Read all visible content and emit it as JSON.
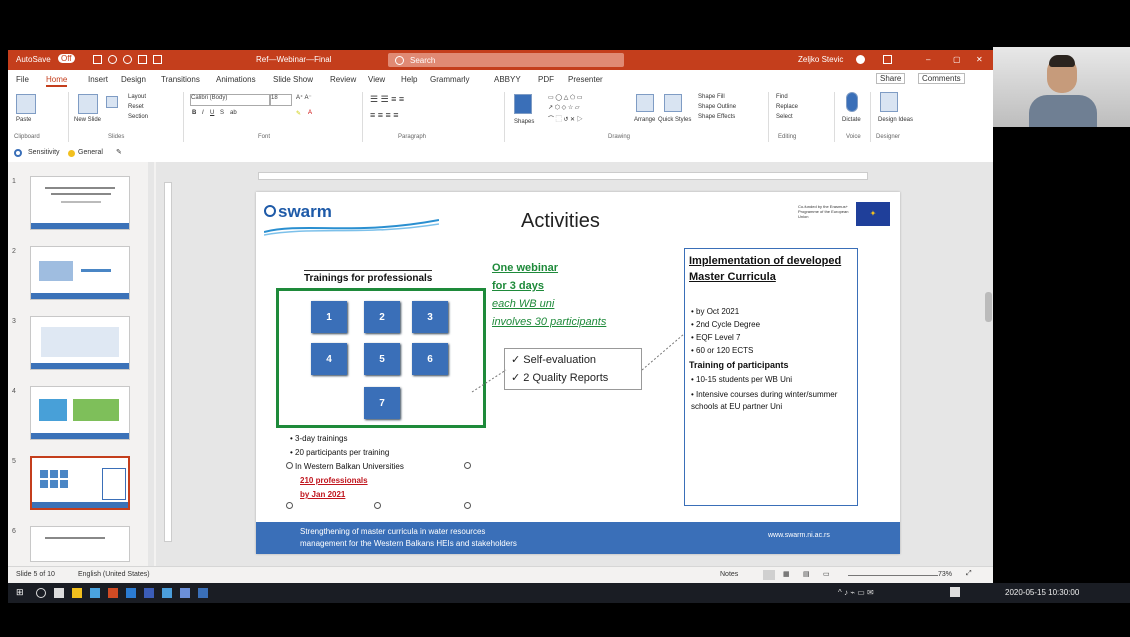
{
  "window": {
    "autosave": "AutoSave",
    "autosave_state": "Off",
    "doc_title": "Ref—Webinar—Final",
    "search_placeholder": "Search",
    "user": "Zeljko Stevic",
    "window_controls": [
      "minimize-icon",
      "restore-icon",
      "close-icon"
    ]
  },
  "menu": {
    "tabs": [
      "File",
      "Home",
      "Insert",
      "Design",
      "Transitions",
      "Animations",
      "Slide Show",
      "Review",
      "View",
      "Help",
      "Grammarly",
      "ABBYY",
      "PDF",
      "Presenter"
    ],
    "active": "Home",
    "share": "Share",
    "comments": "Comments"
  },
  "ribbon": {
    "groups": [
      "Clipboard",
      "Slides",
      "Font",
      "Paragraph",
      "Drawing",
      "Editing",
      "Voice",
      "Designer"
    ],
    "paste": "Paste",
    "new_slide": "New Slide",
    "layout": "Layout",
    "reset": "Reset",
    "section": "Section",
    "font_name": "Calibri (Body)",
    "font_size": "18",
    "shapes": "Shapes",
    "arrange": "Arrange",
    "quick_styles": "Quick Styles",
    "shape_fill": "Shape Fill",
    "shape_outline": "Shape Outline",
    "shape_effects": "Shape Effects",
    "find": "Find",
    "replace": "Replace",
    "select": "Select",
    "dictate": "Dictate",
    "design_ideas": "Design Ideas"
  },
  "quickbar": {
    "sensitivity": "Sensitivity",
    "label": "General"
  },
  "thumbs": [
    "1",
    "2",
    "3",
    "4",
    "5",
    "6"
  ],
  "slide": {
    "logo": "swarm",
    "title": "Activities",
    "eu_text": "Co-funded by the Erasmus+ Programme of the European Union",
    "trainings_heading": "Trainings for professionals",
    "tiles": [
      "1",
      "2",
      "3",
      "4",
      "5",
      "6",
      "7"
    ],
    "bullets": [
      "3-day trainings",
      "20 participants per training",
      "In Western Balkan Universities",
      "210 professionals",
      "by Jan 2021"
    ],
    "webinar": [
      "One webinar",
      "for 3 days",
      "each WB uni",
      "involves 30 participants"
    ],
    "checks": [
      "Self-evaluation",
      "2 Quality Reports"
    ],
    "right_heading": "Implementation of developed Master Curricula",
    "right_bullets": [
      "by Oct 2021",
      "2nd Cycle Degree",
      "EQF Level 7",
      "60 or 120 ECTS"
    ],
    "right_heading2": "Training of participants",
    "right_bullets2": [
      "10-15 students per WB Uni",
      "Intensive courses during winter/summer schools at EU partner Uni"
    ],
    "footer_line1": "Strengthening of master curricula in water resources",
    "footer_line2": "management for the Western Balkans HEIs and stakeholders",
    "footer_right": "www.swarm.ni.ac.rs"
  },
  "status": {
    "slide": "Slide 5 of 10",
    "language": "English (United States)",
    "notes": "Notes",
    "zoom": "73%"
  },
  "taskbar": {
    "clock": "2020-05-15 10:30:00"
  },
  "colors": {
    "accent": "#c43e1c",
    "tile_blue": "#3a6fb8",
    "group_green": "#1e8a3a",
    "red_text": "#c0141c"
  }
}
